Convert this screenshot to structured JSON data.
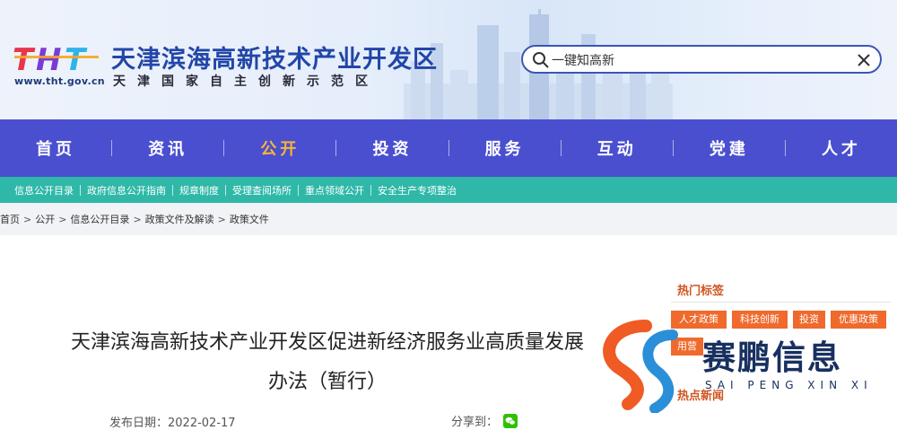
{
  "header": {
    "logo_text": "THT",
    "site_url": "www.tht.gov.cn",
    "site_title": "天津滨海高新技术产业开发区",
    "site_subtitle": "天津国家自主创新示范区",
    "search": {
      "placeholder": "一键知高新",
      "value": "一键知高新"
    }
  },
  "main_nav": {
    "items": [
      {
        "label": "首页"
      },
      {
        "label": "资讯"
      },
      {
        "label": "公开"
      },
      {
        "label": "投资"
      },
      {
        "label": "服务"
      },
      {
        "label": "互动"
      },
      {
        "label": "党建"
      },
      {
        "label": "人才"
      }
    ],
    "active_index": 2,
    "background": "#4a4fcf",
    "active_color": "#f7b53a"
  },
  "sub_nav": {
    "items": [
      {
        "label": "信息公开目录"
      },
      {
        "label": "政府信息公开指南"
      },
      {
        "label": "规章制度"
      },
      {
        "label": "受理查阅场所"
      },
      {
        "label": "重点领域公开"
      },
      {
        "label": "安全生产专项整治"
      }
    ],
    "background": "#2fb8a8"
  },
  "breadcrumb": {
    "items": [
      "首页",
      "公开",
      "信息公开目录",
      "政策文件及解读",
      "政策文件"
    ],
    "separator": ">"
  },
  "article": {
    "title_line1": "天津滨海高新技术产业开发区促进新经济服务业高质量发展",
    "title_line2": "办法（暂行）",
    "pub_date_label": "发布日期：",
    "pub_date": "2022-02-17",
    "share_label": "分享到："
  },
  "sidebar": {
    "hot_tags_title": "热门标签",
    "tags": [
      "人才政策",
      "科技创新",
      "投资",
      "优惠政策",
      "用营"
    ],
    "hot_news_title": "热点新闻",
    "tag_color": "#ef6a2c"
  },
  "watermark": {
    "text": "赛鹏信息",
    "sub": "SAI PENG XIN XI"
  }
}
